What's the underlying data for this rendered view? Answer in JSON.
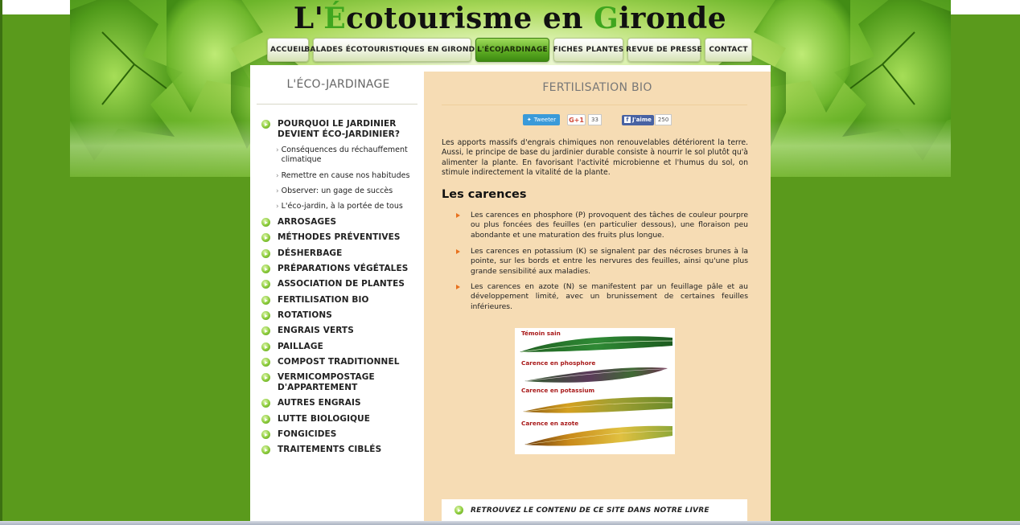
{
  "site": {
    "title_parts": [
      {
        "text": "L'",
        "hl": false
      },
      {
        "text": "É",
        "hl": true
      },
      {
        "text": "cotourisme en ",
        "hl": false
      },
      {
        "text": "G",
        "hl": true
      },
      {
        "text": "ironde",
        "hl": false
      }
    ]
  },
  "nav": {
    "items": [
      {
        "label": "ACCUEIL",
        "active": false
      },
      {
        "label": "BALADES ÉCOTOURISTIQUES EN GIRONDE",
        "active": false
      },
      {
        "label": "L'ÉCOJARDINAGE",
        "active": true
      },
      {
        "label": "FICHES PLANTES",
        "active": false
      },
      {
        "label": "REVUE DE PRESSE",
        "active": false
      },
      {
        "label": "CONTACT",
        "active": false
      }
    ]
  },
  "sidebar": {
    "title": "L'ÉCO-JARDINAGE",
    "first_item": "POURQUOI LE JARDINIER DEVIENT ÉCO-JARDINIER?",
    "sub_items": [
      "Conséquences du réchauffement climatique",
      "Remettre en cause nos habitudes",
      "Observer: un gage de succès",
      "L'éco-jardin, à la portée de tous"
    ],
    "items": [
      "ARROSAGES",
      "MÉTHODES PRÉVENTIVES",
      "DÉSHERBAGE",
      "PRÉPARATIONS VÉGÉTALES",
      "ASSOCIATION DE PLANTES",
      "FERTILISATION BIO",
      "ROTATIONS",
      "ENGRAIS VERTS",
      "PAILLAGE",
      "COMPOST TRADITIONNEL",
      "VERMICOMPOSTAGE D'APPARTEMENT",
      "AUTRES ENGRAIS",
      "LUTTE BIOLOGIQUE",
      "FONGICIDES",
      "TRAITEMENTS CIBLÉS"
    ]
  },
  "main": {
    "page_title": "FERTILISATION BIO",
    "social": {
      "tweet_label": "Tweeter",
      "gplus_label": "G+1",
      "gplus_count": "33",
      "fb_label": "J'aime",
      "fb_count": "250"
    },
    "intro": "Les apports massifs d'engrais chimiques non renouvelables détériorent la terre. Aussi, le principe de base du jardinier durable consiste à nourrir le sol plutôt qu'à alimenter la plante. En favorisant l'activité microbienne et l'humus du sol, on stimule indirectement la vitalité de la plante.",
    "section_heading": "Les carences",
    "bullets": [
      "Les carences en phosphore (P) provoquent des tâches de couleur pourpre ou plus foncées des feuilles (en particulier dessous), une floraison peu abondante et une maturation des fruits plus longue.",
      "Les carences en potassium (K) se signalent par des nécroses brunes à la pointe, sur les bords et entre les nervures des feuilles, ainsi qu'une plus grande sensibilité aux maladies.",
      "Les carences en azote (N) se manifestent par un feuillage pâle et au développement limité, avec un brunissement de certaines feuilles inférieures."
    ],
    "figure_labels": [
      "Témoin sain",
      "Carence en phosphore",
      "Carence en potassium",
      "Carence en azote"
    ],
    "book_link": "RETROUVEZ LE CONTENU DE CE SITE DANS NOTRE LIVRE"
  },
  "colors": {
    "page_bg": "#5a9a1c",
    "content_bg": "#f6dcb4",
    "accent_green": "#3fa61f",
    "bullet_orange": "#e8711e"
  }
}
